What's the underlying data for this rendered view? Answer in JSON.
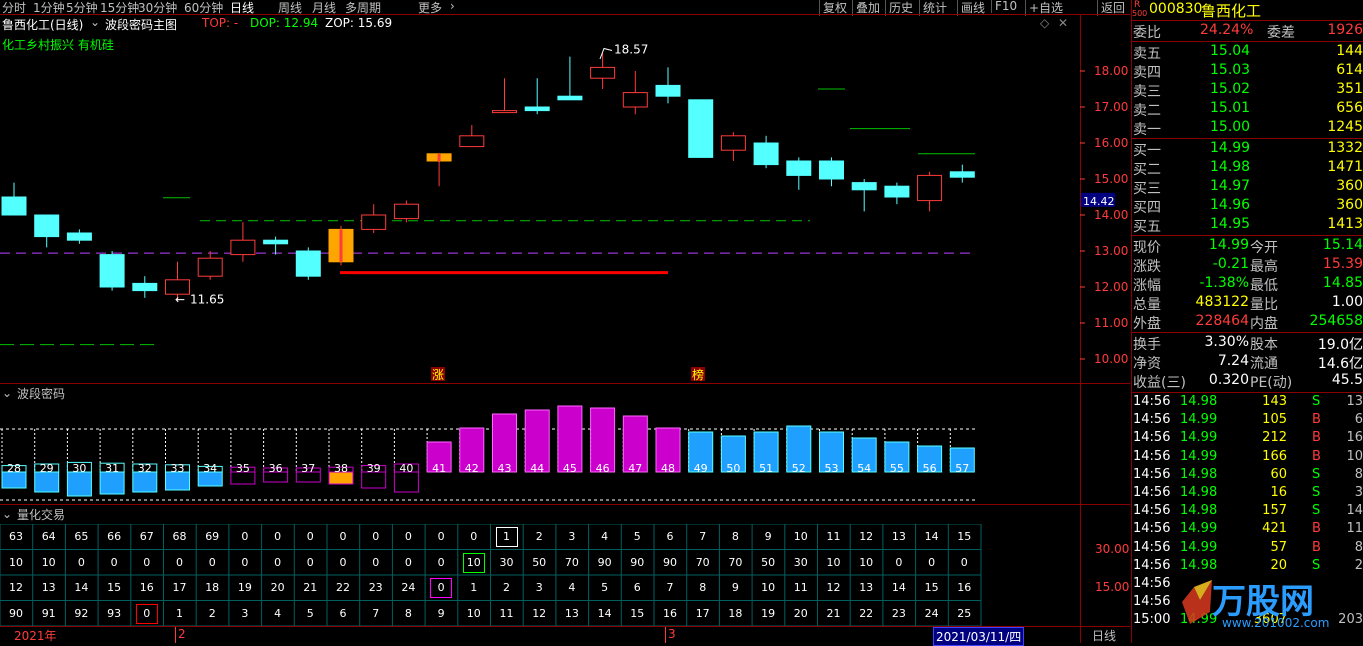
{
  "toolbar": {
    "periods": [
      "分时",
      "1分钟",
      "5分钟",
      "15分钟",
      "30分钟",
      "60分钟",
      "日线",
      "周线",
      "月线",
      "多周期",
      "更多"
    ],
    "active_period": "日线",
    "right_buttons": [
      "复权",
      "叠加",
      "历史",
      "统计",
      "画线",
      "F10",
      "+自选",
      "返回"
    ]
  },
  "main_chart": {
    "title": "鲁西化工(日线)",
    "indicator_name": "波段密码主图",
    "top_label": "TOP: -",
    "dop_label": "DOP: 12.94",
    "zop_label": "ZOP: 15.69",
    "concept_text": "化工乡村振兴 有机硅",
    "price_axis": [
      "18.00",
      "17.00",
      "16.00",
      "15.00",
      "14.00",
      "13.00",
      "12.00",
      "11.00",
      "10.00"
    ],
    "current_price_tag": "14.42",
    "high_label": "18.57",
    "low_label": "11.65",
    "marker_zhang": "涨",
    "marker_bang": "榜"
  },
  "candles": [
    {
      "o": 14.0,
      "c": 14.5,
      "h": 14.9,
      "l": 14.0,
      "up": false
    },
    {
      "o": 14.0,
      "c": 13.4,
      "h": 14.0,
      "l": 13.1,
      "up": false
    },
    {
      "o": 13.5,
      "c": 13.3,
      "h": 13.6,
      "l": 13.2,
      "up": false
    },
    {
      "o": 12.9,
      "c": 12.0,
      "h": 13.0,
      "l": 11.9,
      "up": false
    },
    {
      "o": 12.1,
      "c": 11.9,
      "h": 12.3,
      "l": 11.7,
      "up": false
    },
    {
      "o": 11.8,
      "c": 12.2,
      "h": 12.7,
      "l": 11.6,
      "up": true
    },
    {
      "o": 12.3,
      "c": 12.8,
      "h": 13.0,
      "l": 12.2,
      "up": true
    },
    {
      "o": 12.9,
      "c": 13.3,
      "h": 13.8,
      "l": 12.7,
      "up": true
    },
    {
      "o": 13.3,
      "c": 13.2,
      "h": 13.4,
      "l": 12.9,
      "up": false
    },
    {
      "o": 13.0,
      "c": 12.3,
      "h": 13.1,
      "l": 12.2,
      "up": false
    },
    {
      "o": 12.7,
      "c": 13.6,
      "h": 13.7,
      "l": 12.6,
      "up": true,
      "yellow": true
    },
    {
      "o": 13.6,
      "c": 14.0,
      "h": 14.3,
      "l": 13.5,
      "up": true
    },
    {
      "o": 13.9,
      "c": 14.3,
      "h": 14.4,
      "l": 13.8,
      "up": true
    },
    {
      "o": 15.5,
      "c": 15.7,
      "h": 15.7,
      "l": 14.8,
      "up": true,
      "yellow": true
    },
    {
      "o": 15.9,
      "c": 16.2,
      "h": 16.5,
      "l": 15.9,
      "up": true
    },
    {
      "o": 16.9,
      "c": 16.9,
      "h": 17.8,
      "l": 16.9,
      "up": true
    },
    {
      "o": 16.9,
      "c": 17.0,
      "h": 17.8,
      "l": 16.8,
      "up": false
    },
    {
      "o": 17.3,
      "c": 17.2,
      "h": 18.4,
      "l": 17.2,
      "up": false
    },
    {
      "o": 17.8,
      "c": 18.1,
      "h": 18.5,
      "l": 17.5,
      "up": true
    },
    {
      "o": 17.0,
      "c": 17.4,
      "h": 18.0,
      "l": 16.8,
      "up": true
    },
    {
      "o": 17.6,
      "c": 17.3,
      "h": 18.1,
      "l": 17.1,
      "up": false
    },
    {
      "o": 17.2,
      "c": 15.6,
      "h": 17.2,
      "l": 15.6,
      "up": false
    },
    {
      "o": 15.8,
      "c": 16.2,
      "h": 16.3,
      "l": 15.5,
      "up": true
    },
    {
      "o": 16.0,
      "c": 15.4,
      "h": 16.2,
      "l": 15.3,
      "up": false
    },
    {
      "o": 15.5,
      "c": 15.1,
      "h": 15.6,
      "l": 14.7,
      "up": false
    },
    {
      "o": 15.5,
      "c": 15.0,
      "h": 15.6,
      "l": 14.8,
      "up": false
    },
    {
      "o": 14.9,
      "c": 14.7,
      "h": 15.0,
      "l": 14.1,
      "up": false
    },
    {
      "o": 14.8,
      "c": 14.5,
      "h": 14.9,
      "l": 14.3,
      "up": false
    },
    {
      "o": 14.4,
      "c": 15.1,
      "h": 15.2,
      "l": 14.1,
      "up": true
    },
    {
      "o": 15.2,
      "c": 15.05,
      "h": 15.4,
      "l": 14.9,
      "up": false
    }
  ],
  "sub1": {
    "title": "波段密码",
    "labels": [
      "28",
      "29",
      "30",
      "31",
      "32",
      "33",
      "34",
      "35",
      "36",
      "37",
      "38",
      "39",
      "40",
      "41",
      "42",
      "43",
      "44",
      "45",
      "46",
      "47",
      "48",
      "49",
      "50",
      "51",
      "52",
      "53",
      "54",
      "55",
      "56",
      "57"
    ]
  },
  "sub2": {
    "title": "量化交易",
    "axis": [
      "30.00",
      "15.00"
    ],
    "rows": [
      [
        "63",
        "64",
        "65",
        "66",
        "67",
        "68",
        "69",
        "0",
        "0",
        "0",
        "0",
        "0",
        "0",
        "0",
        "0",
        "1",
        "2",
        "3",
        "4",
        "5",
        "6",
        "7",
        "8",
        "9",
        "10",
        "11",
        "12",
        "13",
        "14",
        "15"
      ],
      [
        "10",
        "10",
        "0",
        "0",
        "0",
        "0",
        "0",
        "0",
        "0",
        "0",
        "0",
        "0",
        "0",
        "0",
        "10",
        "30",
        "50",
        "70",
        "90",
        "90",
        "90",
        "70",
        "70",
        "50",
        "30",
        "10",
        "10",
        "0",
        "0",
        "0"
      ],
      [
        "12",
        "13",
        "14",
        "15",
        "16",
        "17",
        "18",
        "19",
        "20",
        "21",
        "22",
        "23",
        "24",
        "0",
        "1",
        "2",
        "3",
        "4",
        "5",
        "6",
        "7",
        "8",
        "9",
        "10",
        "11",
        "12",
        "13",
        "14",
        "15",
        "16"
      ],
      [
        "90",
        "91",
        "92",
        "93",
        "0",
        "1",
        "2",
        "3",
        "4",
        "5",
        "6",
        "7",
        "8",
        "9",
        "10",
        "11",
        "12",
        "13",
        "14",
        "15",
        "16",
        "17",
        "18",
        "19",
        "20",
        "21",
        "22",
        "23",
        "24",
        "25"
      ]
    ]
  },
  "date_axis": {
    "year": "2021年",
    "m2": "2",
    "m3": "3",
    "date_box": "2021/03/11/四",
    "period": "日线"
  },
  "quote": {
    "code": "000830",
    "name": "鲁西化工",
    "badge_r": "R",
    "badge_500": "500",
    "weibi_label": "委比",
    "weibi": "24.24%",
    "weicha_label": "委差",
    "weicha": "1926",
    "asks": [
      {
        "label": "卖五",
        "price": "15.04",
        "vol": "144"
      },
      {
        "label": "卖四",
        "price": "15.03",
        "vol": "614"
      },
      {
        "label": "卖三",
        "price": "15.02",
        "vol": "351"
      },
      {
        "label": "卖二",
        "price": "15.01",
        "vol": "656"
      },
      {
        "label": "卖一",
        "price": "15.00",
        "vol": "1245"
      }
    ],
    "bids": [
      {
        "label": "买一",
        "price": "14.99",
        "vol": "1332"
      },
      {
        "label": "买二",
        "price": "14.98",
        "vol": "1471"
      },
      {
        "label": "买三",
        "price": "14.97",
        "vol": "360"
      },
      {
        "label": "买四",
        "price": "14.96",
        "vol": "360"
      },
      {
        "label": "买五",
        "price": "14.95",
        "vol": "1413"
      }
    ],
    "stats": [
      {
        "l1": "现价",
        "v1": "14.99",
        "l2": "今开",
        "v2": "15.14",
        "c1": "#00ff00",
        "c2": "#00ff00"
      },
      {
        "l1": "涨跌",
        "v1": "-0.21",
        "l2": "最高",
        "v2": "15.39",
        "c1": "#00ff00",
        "c2": "#ff3b3b"
      },
      {
        "l1": "涨幅",
        "v1": "-1.38%",
        "l2": "最低",
        "v2": "14.85",
        "c1": "#00ff00",
        "c2": "#00ff00"
      },
      {
        "l1": "总量",
        "v1": "483122",
        "l2": "量比",
        "v2": "1.00",
        "c1": "#ffff00",
        "c2": "#ffffff"
      },
      {
        "l1": "外盘",
        "v1": "228464",
        "l2": "内盘",
        "v2": "254658",
        "c1": "#ff3b3b",
        "c2": "#00ff00"
      }
    ],
    "stats2": [
      {
        "l1": "换手",
        "v1": "3.30%",
        "l2": "股本",
        "v2": "19.0亿"
      },
      {
        "l1": "净资",
        "v1": "7.24",
        "l2": "流通",
        "v2": "14.6亿"
      },
      {
        "l1": "收益(三)",
        "v1": "0.320",
        "l2": "PE(动)",
        "v2": "45.5"
      }
    ],
    "ticks": [
      {
        "t": "14:56",
        "p": "14.98",
        "v": "143",
        "s": "S",
        "n": "13"
      },
      {
        "t": "14:56",
        "p": "14.99",
        "v": "105",
        "s": "B",
        "n": "6"
      },
      {
        "t": "14:56",
        "p": "14.99",
        "v": "212",
        "s": "B",
        "n": "16"
      },
      {
        "t": "14:56",
        "p": "14.99",
        "v": "166",
        "s": "B",
        "n": "10"
      },
      {
        "t": "14:56",
        "p": "14.98",
        "v": "60",
        "s": "S",
        "n": "8"
      },
      {
        "t": "14:56",
        "p": "14.98",
        "v": "16",
        "s": "S",
        "n": "3"
      },
      {
        "t": "14:56",
        "p": "14.98",
        "v": "157",
        "s": "S",
        "n": "14"
      },
      {
        "t": "14:56",
        "p": "14.99",
        "v": "421",
        "s": "B",
        "n": "11"
      },
      {
        "t": "14:56",
        "p": "14.99",
        "v": "57",
        "s": "B",
        "n": "8"
      },
      {
        "t": "14:56",
        "p": "14.98",
        "v": "20",
        "s": "S",
        "n": "2"
      },
      {
        "t": "14:56",
        "p": "",
        "v": "",
        "s": "",
        "n": ""
      },
      {
        "t": "14:56",
        "p": "",
        "v": "",
        "s": "",
        "n": ""
      },
      {
        "t": "15:00",
        "p": "14.99",
        "v": "3607",
        "s": "",
        "n": "203"
      }
    ],
    "watermark": "万股网",
    "watermark_url": "www.201002.com"
  }
}
